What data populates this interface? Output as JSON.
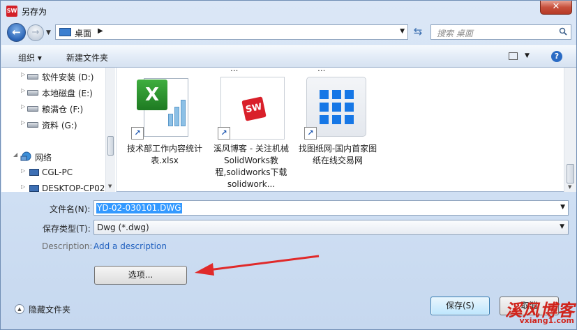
{
  "window": {
    "title": "另存为",
    "close_glyph": "✕"
  },
  "address": {
    "location": "桌面",
    "search_placeholder": "搜索 桌面"
  },
  "toolbar": {
    "organize_label": "组织 ▾",
    "new_folder_label": "新建文件夹",
    "help_glyph": "?"
  },
  "nav_tree": {
    "items": [
      {
        "label": "软件安装 (D:)",
        "icon": "drive-icon"
      },
      {
        "label": "本地磁盘 (E:)",
        "icon": "drive-icon"
      },
      {
        "label": "粮满仓 (F:)",
        "icon": "drive-icon"
      },
      {
        "label": "资料 (G:)",
        "icon": "drive-icon"
      },
      {
        "label": "网络",
        "icon": "network-icon"
      },
      {
        "label": "CGL-PC",
        "icon": "computer-icon"
      },
      {
        "label": "DESKTOP-CP02",
        "icon": "computer-icon"
      }
    ]
  },
  "files": {
    "partial_labels": [
      "...",
      "..."
    ],
    "items": [
      {
        "name": "技术部工作内容统计表.xlsx",
        "icon": "excel-file-icon"
      },
      {
        "name": "溪风博客 - 关注机械SolidWorks教程,solidworks下载solidwork...",
        "icon": "solidworks-shortcut-icon"
      },
      {
        "name": "找图纸网-国内首家图纸在线交易网",
        "icon": "grid-app-icon"
      }
    ]
  },
  "form": {
    "filename_label": "文件名(N):",
    "filename_value": "YD-02-030101.DWG",
    "filetype_label": "保存类型(T):",
    "filetype_value": "Dwg (*.dwg)",
    "description_label": "Description:",
    "description_link": "Add a description",
    "options_label": "选项..."
  },
  "footer": {
    "hide_folders_label": "隐藏文件夹",
    "save_label": "保存(S)",
    "cancel_label": "取消"
  },
  "watermark": {
    "title": "溪风博客",
    "url": "vxiang1.com"
  },
  "colors": {
    "accent": "#3399ff",
    "annotation_arrow": "#e02a2a",
    "watermark": "#d0241c"
  }
}
